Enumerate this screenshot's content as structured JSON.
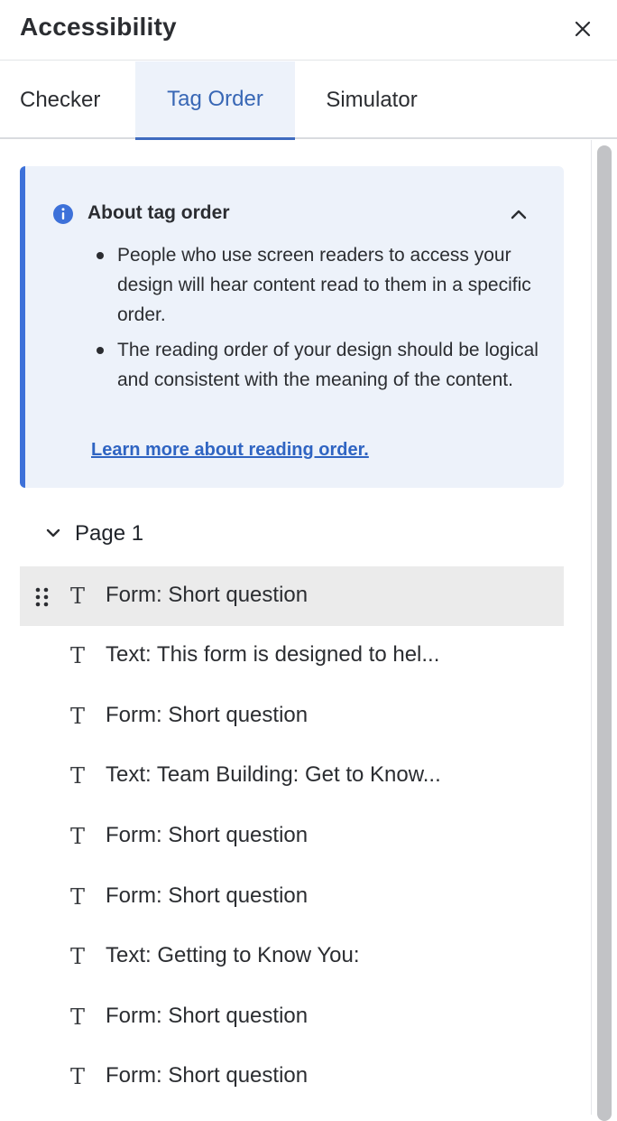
{
  "panel": {
    "title": "Accessibility"
  },
  "tabs": [
    {
      "label": "Checker"
    },
    {
      "label": "Tag Order"
    },
    {
      "label": "Simulator"
    }
  ],
  "info": {
    "title": "About tag order",
    "bullets": [
      "People who use screen readers to access your design will hear content read to them in a specific order.",
      "The reading order of your design should be logical and consistent with the meaning of the content."
    ],
    "link": "Learn more about reading order.",
    "accent_color": "#3d71d9"
  },
  "tree": {
    "page_label": "Page 1",
    "items": [
      {
        "label": "Form: Short question",
        "selected": true
      },
      {
        "label": "Text: This form is designed to hel..."
      },
      {
        "label": "Form: Short question"
      },
      {
        "label": "Text: Team Building: Get to Know..."
      },
      {
        "label": "Form: Short question"
      },
      {
        "label": "Form: Short question"
      },
      {
        "label": "Text: Getting to Know You:"
      },
      {
        "label": "Form: Short question"
      },
      {
        "label": "Form: Short question"
      }
    ]
  }
}
